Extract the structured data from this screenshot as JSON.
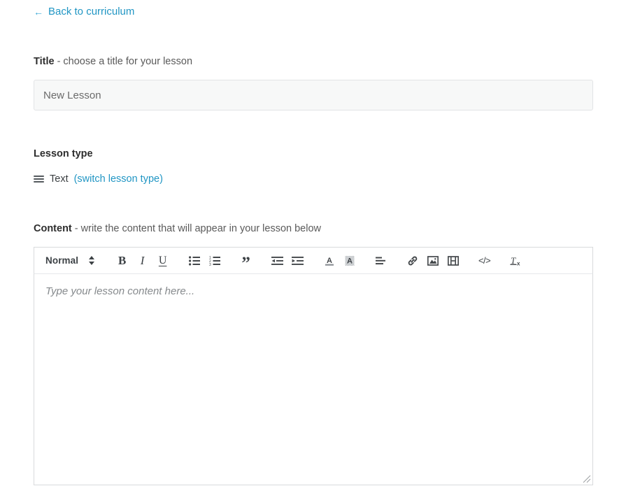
{
  "back_nav": {
    "icon": "arrow-left-icon",
    "label": "Back to curriculum",
    "color": "#2196c4"
  },
  "title_section": {
    "label_bold": "Title",
    "label_rest": " - choose a title for your lesson",
    "input_value": "",
    "input_placeholder": "New Lesson"
  },
  "lesson_type_section": {
    "heading": "Lesson type",
    "type_icon": "text-lines-icon",
    "type_name": "Text",
    "switch_link": "(switch lesson type)"
  },
  "content_section": {
    "label_bold": "Content",
    "label_rest": " - write the content that will appear in your lesson below",
    "editor_placeholder": "Type your lesson content here..."
  },
  "toolbar": {
    "format_select": {
      "value": "Normal",
      "icon": "stepper-updown-icon"
    },
    "buttons": [
      {
        "name": "bold-button",
        "glyph": "B",
        "title": "Bold"
      },
      {
        "name": "italic-button",
        "glyph": "I",
        "title": "Italic"
      },
      {
        "name": "underline-button",
        "glyph": "U",
        "title": "Underline"
      },
      {
        "name": "bullet-list-button",
        "glyph": "",
        "title": "Bulleted list"
      },
      {
        "name": "numbered-list-button",
        "glyph": "",
        "title": "Numbered list"
      },
      {
        "name": "blockquote-button",
        "glyph": "”",
        "title": "Blockquote"
      },
      {
        "name": "outdent-button",
        "glyph": "",
        "title": "Decrease indent"
      },
      {
        "name": "indent-button",
        "glyph": "",
        "title": "Increase indent"
      },
      {
        "name": "text-color-button",
        "glyph": "A",
        "title": "Text color"
      },
      {
        "name": "highlight-color-button",
        "glyph": "A",
        "title": "Background color"
      },
      {
        "name": "align-button",
        "glyph": "",
        "title": "Align"
      },
      {
        "name": "link-button",
        "glyph": "",
        "title": "Insert link"
      },
      {
        "name": "image-button",
        "glyph": "",
        "title": "Insert image"
      },
      {
        "name": "video-button",
        "glyph": "",
        "title": "Insert video"
      },
      {
        "name": "code-block-button",
        "glyph": "</>",
        "title": "Code block"
      },
      {
        "name": "clear-format-button",
        "glyph": "",
        "title": "Clear formatting"
      }
    ]
  },
  "colors": {
    "accent": "#2196c4",
    "text_dark": "#2d2d2d",
    "text_body": "#4a4a4a",
    "input_bg": "#f7f8f8",
    "border": "#d8dadc",
    "placeholder": "#868a8d"
  }
}
